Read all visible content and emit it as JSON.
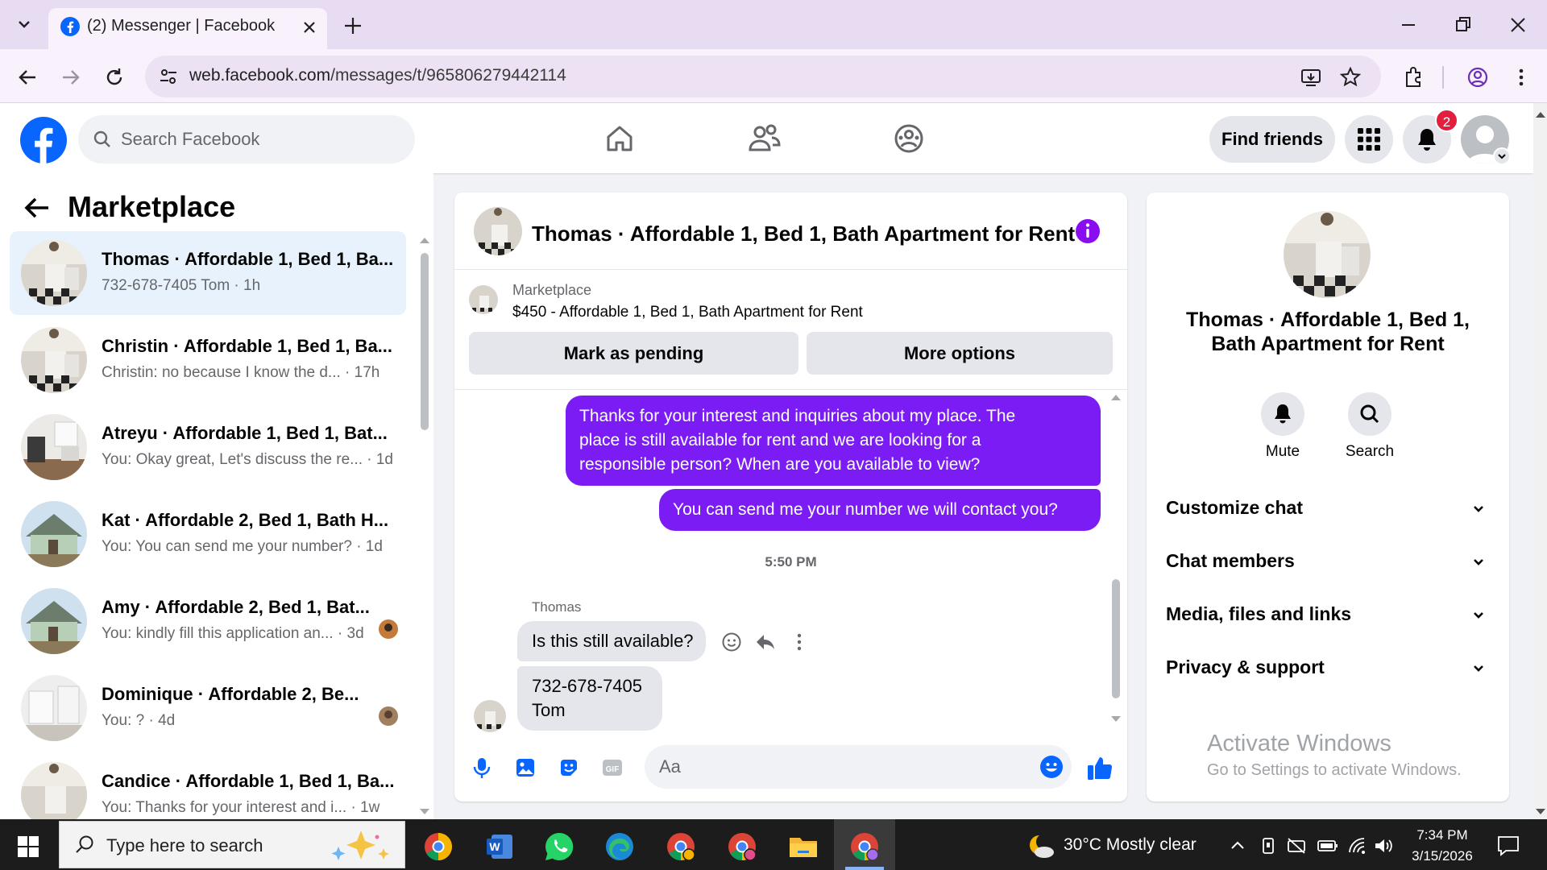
{
  "browser": {
    "tab_title": "(2) Messenger | Facebook",
    "url_host": "web.facebook.com",
    "url_path": "/messages/t/965806279442114"
  },
  "header": {
    "search_placeholder": "Search Facebook",
    "find_friends": "Find friends",
    "notification_count": "2"
  },
  "sidebar": {
    "title": "Marketplace",
    "conversations": [
      {
        "name": "Thomas · Affordable 1, Bed 1, Ba...",
        "preview": "732-678-7405 Tom · 1h"
      },
      {
        "name": "Christin · Affordable 1, Bed 1, Ba...",
        "preview": "Christin: no because I know the d... · 17h"
      },
      {
        "name": "Atreyu · Affordable 1, Bed 1, Bat...",
        "preview": "You: Okay great, Let's discuss the re... · 1d"
      },
      {
        "name": "Kat · Affordable 2, Bed 1, Bath H...",
        "preview": "You: You can send me your number? · 1d"
      },
      {
        "name": "Amy · Affordable 2, Bed 1, Bat...",
        "preview": "You: kindly fill this application an... · 3d"
      },
      {
        "name": "Dominique · Affordable 2, Be...",
        "preview": "You: ? · 4d"
      },
      {
        "name": "Candice · Affordable 1, Bed 1, Ba...",
        "preview": "You: Thanks for your interest and i... · 1w"
      }
    ]
  },
  "chat": {
    "title": "Thomas · Affordable 1, Bed 1, Bath Apartment for Rent",
    "listing_label": "Marketplace",
    "listing": "$450 - Affordable 1, Bed 1, Bath Apartment for Rent",
    "mark_pending": "Mark as pending",
    "more_options": "More options",
    "sent_messages": [
      [
        "Thanks for your interest and inquiries about my place. The",
        "place is still available for rent and we are looking for a",
        "responsible person? When are you available to view?"
      ],
      [
        "You can send me your number we will contact you?"
      ]
    ],
    "timestamp": "5:50 PM",
    "sender_name": "Thomas",
    "received_messages": [
      [
        "Is this still available?"
      ],
      [
        "732-678-7405",
        "Tom"
      ]
    ],
    "composer_placeholder": "Aa"
  },
  "info_panel": {
    "name_line1": "Thomas · Affordable 1, Bed 1,",
    "name_line2": "Bath Apartment for Rent",
    "mute": "Mute",
    "search": "Search",
    "sections": [
      "Customize chat",
      "Chat members",
      "Media, files and links",
      "Privacy & support"
    ],
    "watermark_title": "Activate Windows",
    "watermark_sub": "Go to Settings to activate Windows."
  },
  "taskbar": {
    "search_placeholder": "Type here to search",
    "weather": "30°C  Mostly clear",
    "time": "7:34 PM",
    "date": "3/15/2026"
  },
  "colors": {
    "messenger_purple": "#7c1cf5",
    "facebook_blue": "#0866ff",
    "active_conversation": "#e8f2fc"
  }
}
